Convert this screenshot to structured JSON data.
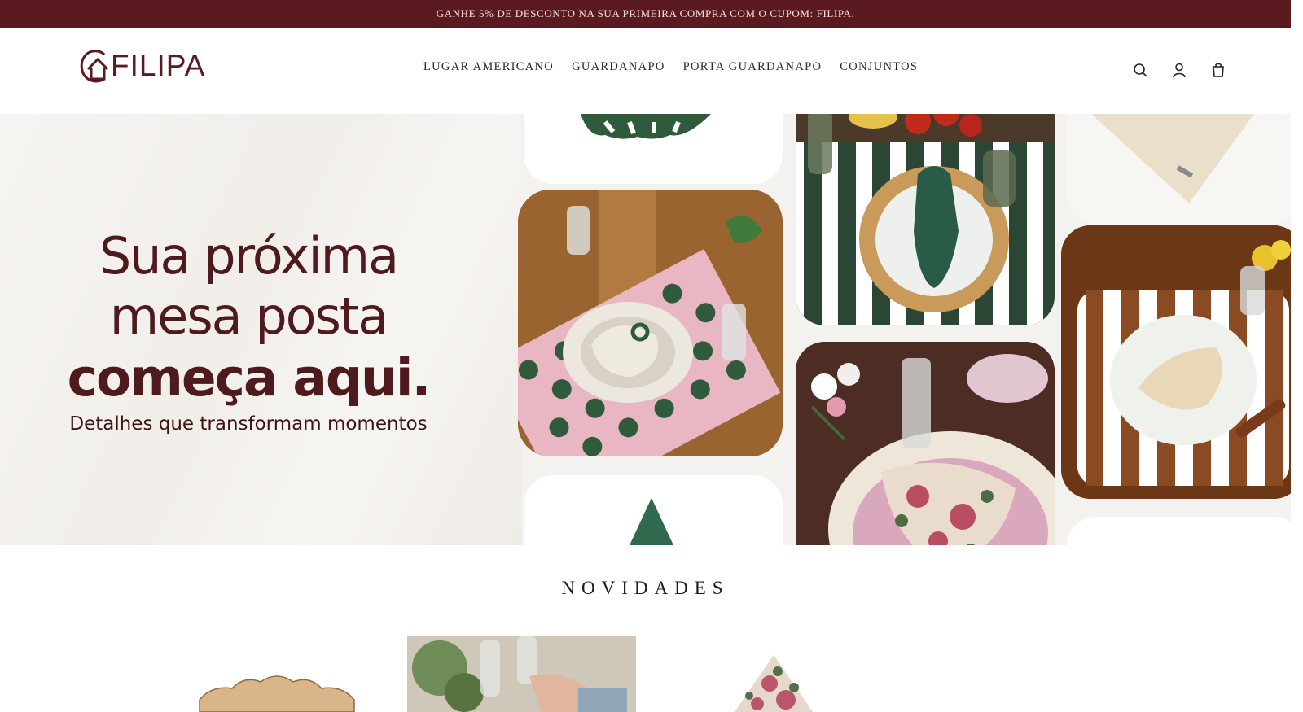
{
  "announcement": {
    "text": "GANHE 5% DE DESCONTO NA SUA PRIMEIRA COMPRA COM O CUPOM: FILIPA."
  },
  "brand": {
    "name": "FILIPA",
    "color": "#5a1a1f"
  },
  "nav": {
    "items": [
      {
        "label": "LUGAR AMERICANO"
      },
      {
        "label": "GUARDANAPO"
      },
      {
        "label": "PORTA GUARDANAPO"
      },
      {
        "label": "CONJUNTOS"
      }
    ]
  },
  "header_icons": [
    "search-icon",
    "account-icon",
    "cart-icon"
  ],
  "hero": {
    "line1": "Sua próxima",
    "line2": "mesa posta",
    "line3": "começa aqui.",
    "subtitle": "Detalhes que transformam momentos"
  },
  "section": {
    "title": "NOVIDADES"
  },
  "colors": {
    "accent": "#5a1a1f",
    "green": "#2f5a3c",
    "pink": "#d98aa0"
  }
}
